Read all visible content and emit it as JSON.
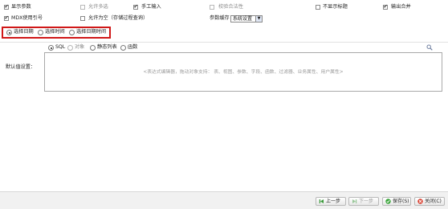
{
  "options": {
    "row1": [
      {
        "label": "显示参数",
        "checked": true,
        "enabled": true
      },
      {
        "label": "允许多选",
        "checked": false,
        "enabled": false
      },
      {
        "label": "手工输入",
        "checked": true,
        "enabled": true
      },
      {
        "label": "校验合法性",
        "checked": false,
        "enabled": false
      },
      {
        "label": "不显示标题",
        "checked": false,
        "enabled": true
      },
      {
        "label": "输出合并",
        "checked": true,
        "enabled": true
      }
    ],
    "row2": [
      {
        "label": "MDX使用引号",
        "checked": true,
        "enabled": true
      },
      {
        "label": "允许为空（存储过程查询）",
        "checked": false,
        "enabled": true
      }
    ]
  },
  "param_cache": {
    "label": "参数缓存",
    "value": "系统设置"
  },
  "date_type": {
    "options": [
      "选择日期",
      "选择时间",
      "选择日期时间"
    ],
    "selected": 0
  },
  "default_value": {
    "label": "默认值设置：",
    "source_options": [
      "SQL",
      "对象",
      "静态列表",
      "函数"
    ],
    "selected": 0,
    "editor_hint": "<表达式编辑器，拖动对象支持：   表、视图、参数、字段、函数、过滤器、业务属性、用户属性>"
  },
  "footer": {
    "prev": "上一步",
    "next": "下一步",
    "save": "保存(S)",
    "close": "关闭(C)"
  }
}
